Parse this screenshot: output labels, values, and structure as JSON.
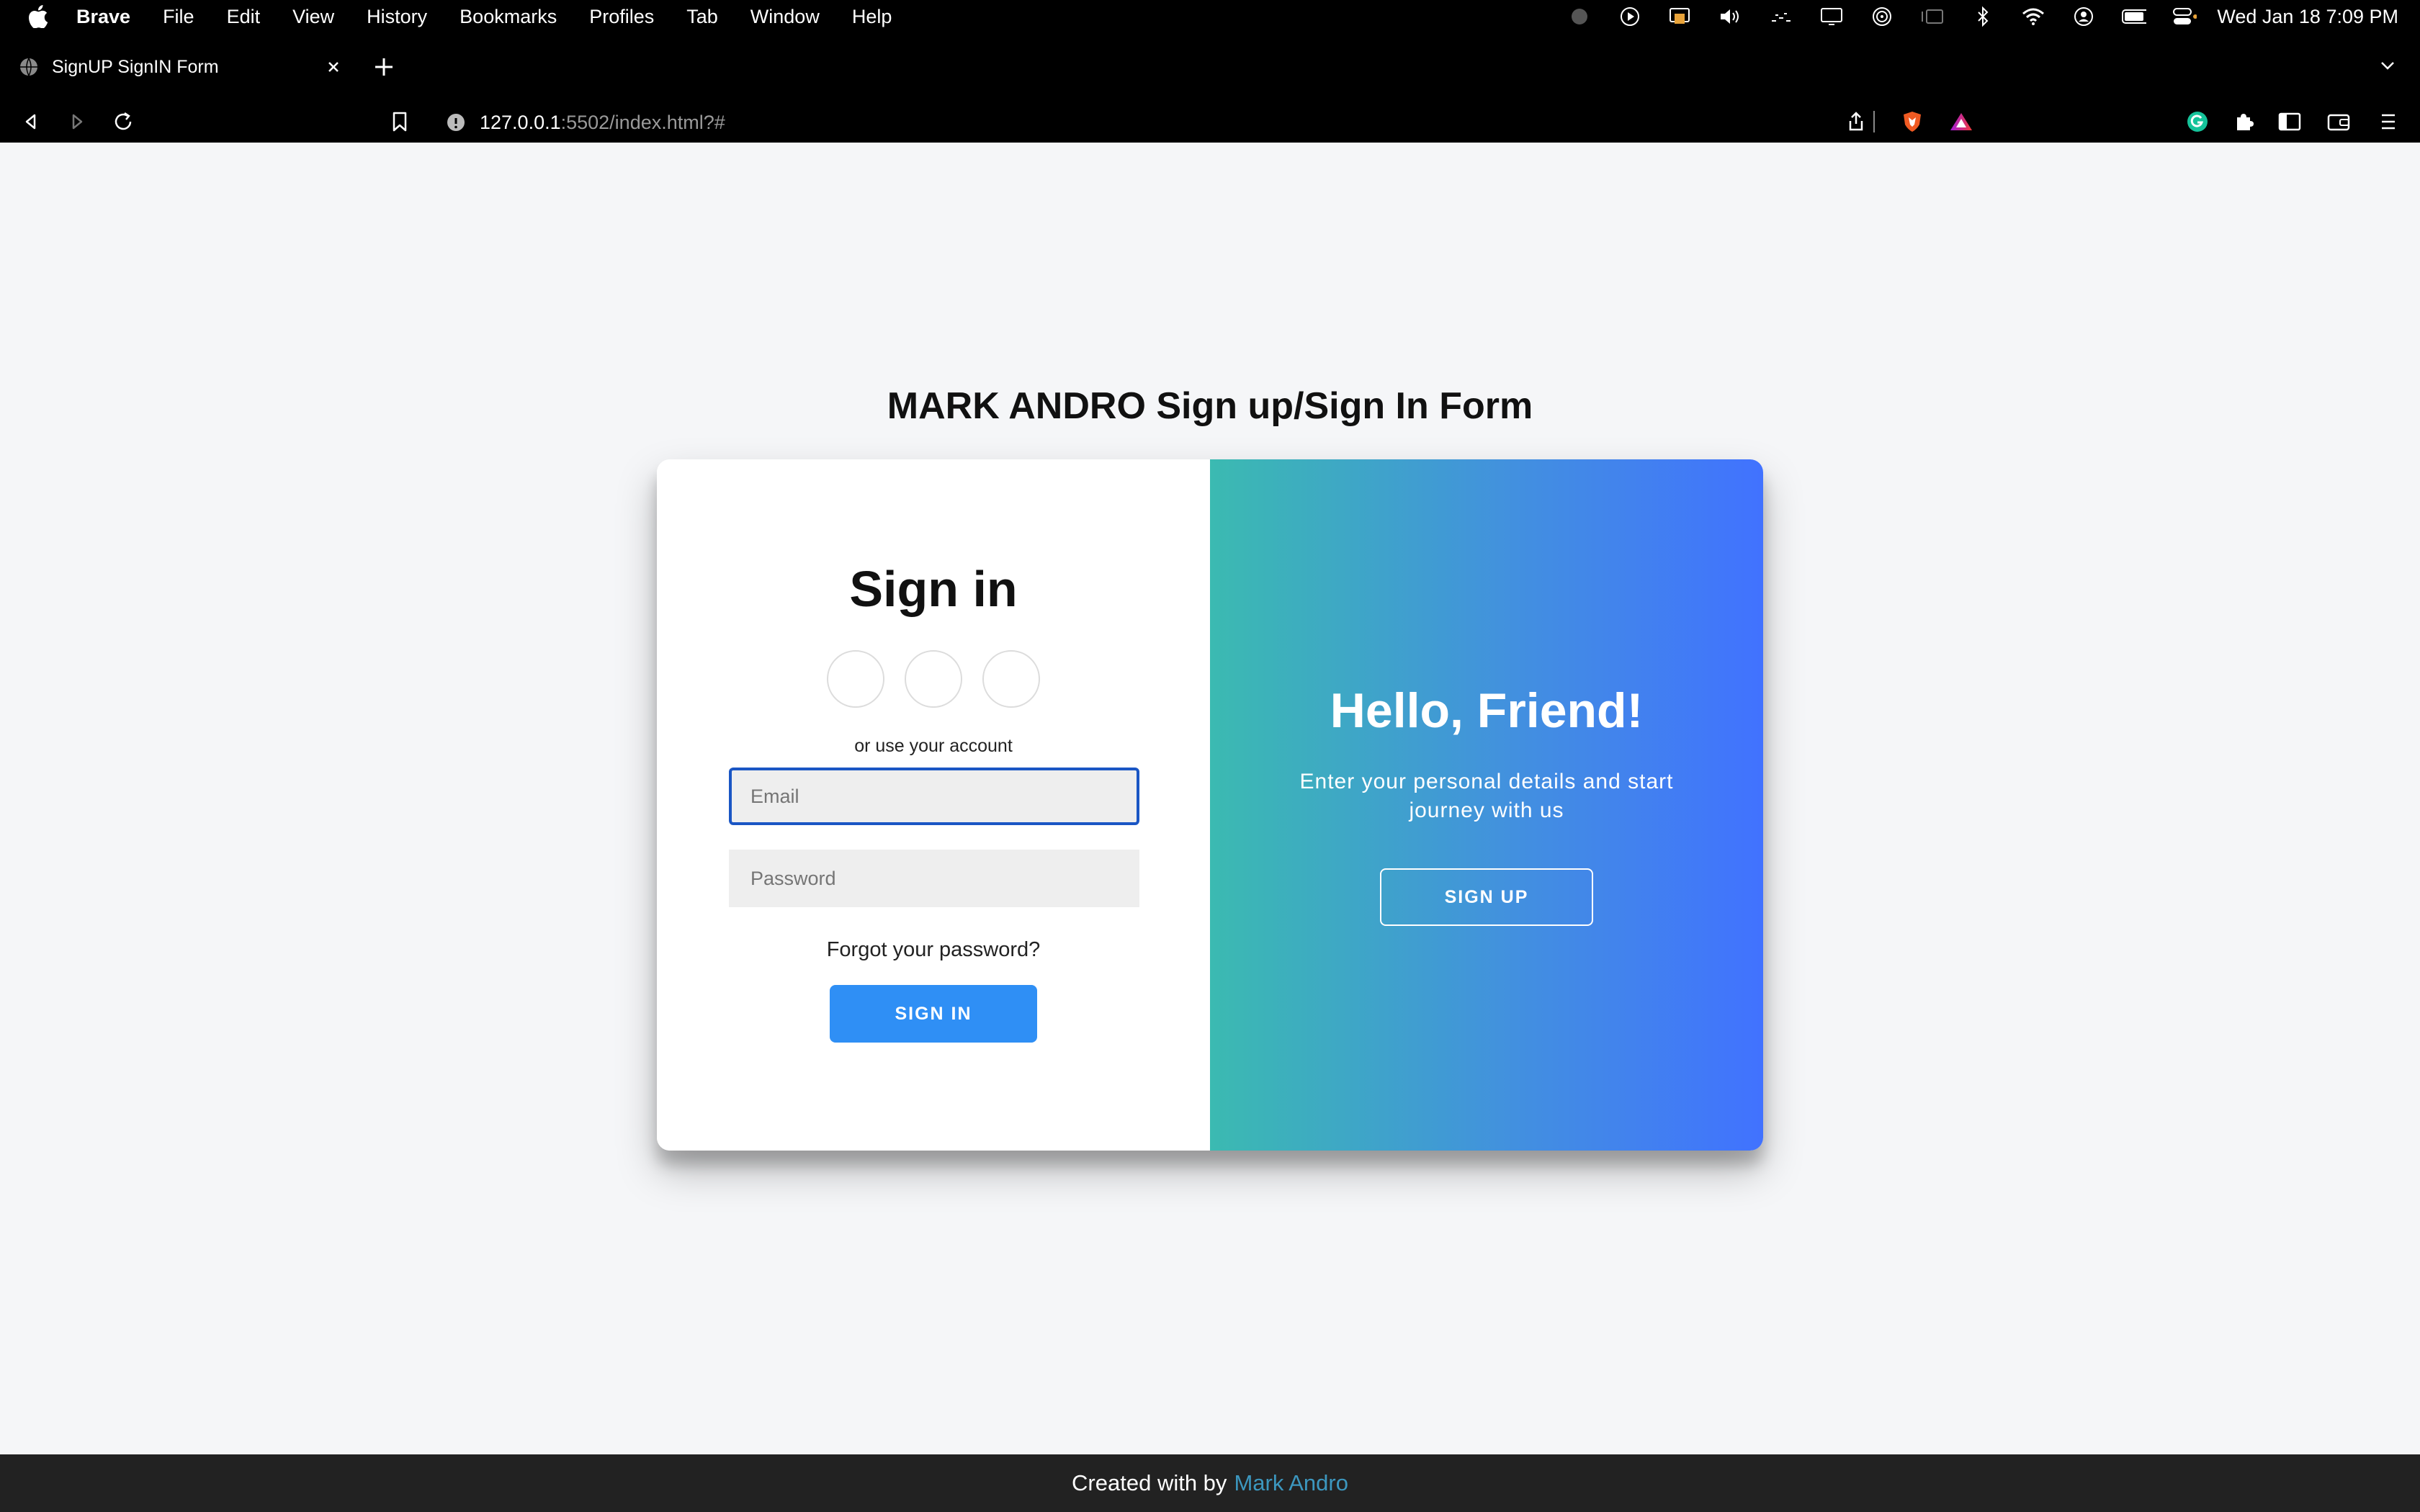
{
  "menubar": {
    "app_name": "Brave",
    "items": [
      "File",
      "Edit",
      "View",
      "History",
      "Bookmarks",
      "Profiles",
      "Tab",
      "Window",
      "Help"
    ],
    "clock": "Wed Jan 18  7:09 PM"
  },
  "tab": {
    "title": "SignUP SignIN Form"
  },
  "address_bar": {
    "host": "127.0.0.1",
    "path": ":5502/index.html?#"
  },
  "page": {
    "title": "MARK ANDRO Sign up/Sign In Form"
  },
  "signin": {
    "heading": "Sign in",
    "or_text": "or use your account",
    "email_placeholder": "Email",
    "password_placeholder": "Password",
    "forgot": "Forgot your password?",
    "button": "SIGN IN"
  },
  "overlay": {
    "heading": "Hello, Friend!",
    "text": "Enter your personal details and start journey with us",
    "button": "SIGN UP"
  },
  "footer": {
    "prefix": "Created with by",
    "author": "Mark Andro"
  },
  "colors": {
    "primary_button": "#2f8ff5",
    "gradient_start": "#3bbab1",
    "gradient_end": "#4172ff",
    "footer_link": "#3c97bf"
  }
}
